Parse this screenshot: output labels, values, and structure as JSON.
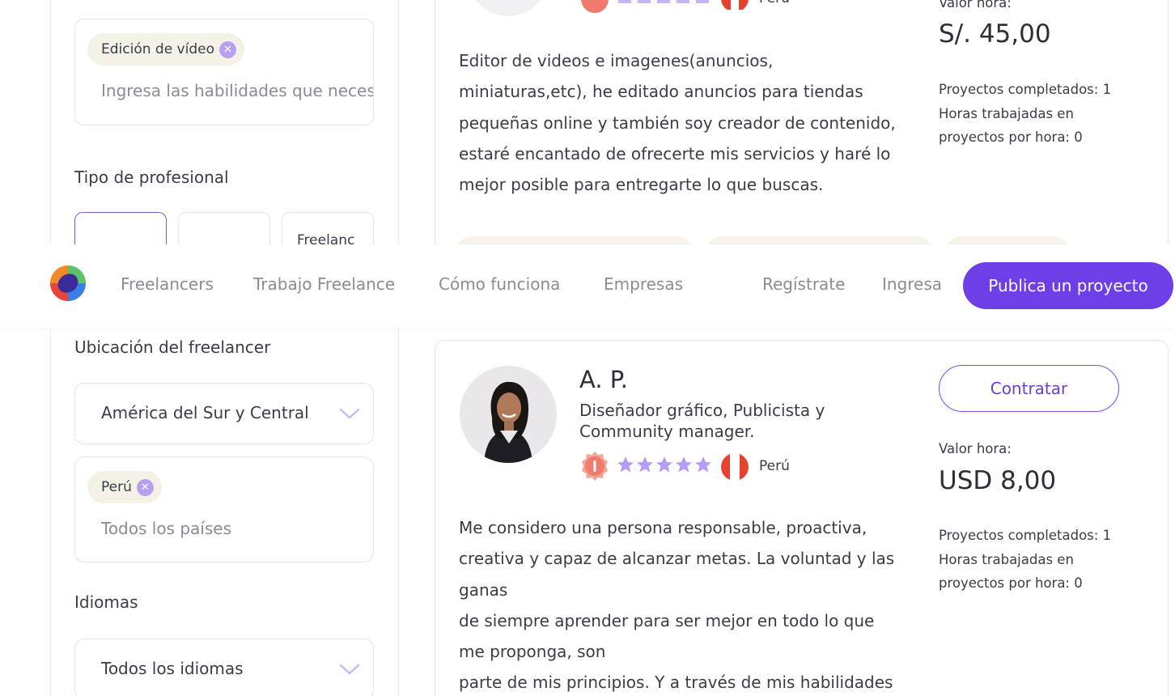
{
  "sidebar": {
    "skills_chip": "Edición de vídeo",
    "skills_placeholder": "Ingresa las habilidades que necesit",
    "professional_type_title": "Tipo de profesional",
    "professional_tab3_label": "Freelanc",
    "location_title": "Ubicación del freelancer",
    "region_select_value": "América del Sur y Central",
    "country_chip": "Perú",
    "country_placeholder": "Todos los países",
    "languages_title": "Idiomas",
    "language_select_value": "Todos los idiomas"
  },
  "navbar": {
    "links": [
      "Freelancers",
      "Trabajo Freelance",
      "Cómo funciona",
      "Empresas"
    ],
    "register": "Regístrate",
    "login": "Ingresa",
    "publish": "Publica un proyecto"
  },
  "card1": {
    "country": "Perú",
    "rate_label": "Valor hora:",
    "rate": "S/. 45,00",
    "description": [
      "Editor de videos e imagenes(anuncios,",
      "miniaturas,etc), he editado anuncios para tiendas",
      "pequeñas online y también soy creador de contenido,",
      "estaré encantado de ofrecerte mis servicios y haré lo",
      "mejor posible para entregarte lo que buscas."
    ],
    "stats": [
      "Proyectos completados: 1",
      "Horas trabajadas en",
      "proyectos por hora: 0"
    ]
  },
  "card2": {
    "name": "A. P.",
    "title_lines": [
      "Diseñador gráfico, Publicista y",
      "Community manager."
    ],
    "country": "Perú",
    "hire": "Contratar",
    "rate_label": "Valor hora:",
    "rate": "USD 8,00",
    "stats": [
      "Proyectos completados: 1",
      "Horas trabajadas en",
      "proyectos por hora: 0"
    ],
    "description": [
      "Me considero una persona responsable, proactiva,",
      "creativa y capaz de alcanzar metas. La voluntad y las",
      "ganas",
      "de siempre aprender para ser mejor en todo lo que",
      "me proponga, son",
      "parte de mis principios. Y a través de mis habilidades"
    ]
  },
  "colors": {
    "accent": "#6e3ee6",
    "chip_bg": "#f4f2e6",
    "chip_close": "#b7a0f2",
    "star": "#b59cf5",
    "badge": "#f07a6e",
    "border": "#e4e1f1"
  },
  "icons": [
    "logo-icon",
    "close-icon",
    "chevron-down-icon",
    "star-icon",
    "badge-icon",
    "peru-flag-icon"
  ]
}
